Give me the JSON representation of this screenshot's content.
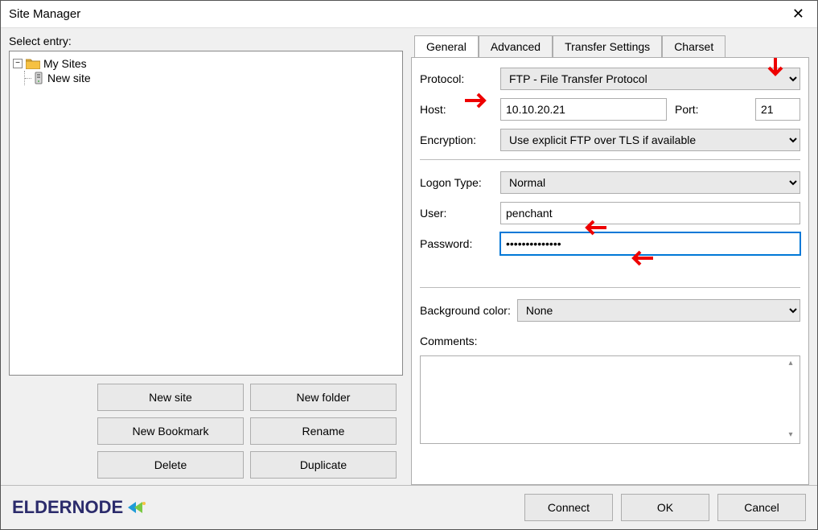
{
  "window": {
    "title": "Site Manager"
  },
  "left": {
    "select_label": "Select entry:",
    "root": {
      "label": "My Sites",
      "expanded": true
    },
    "child": {
      "label": "New site"
    },
    "buttons": {
      "new_site": "New site",
      "new_folder": "New folder",
      "new_bookmark": "New Bookmark",
      "rename": "Rename",
      "delete": "Delete",
      "duplicate": "Duplicate"
    }
  },
  "tabs": {
    "general": "General",
    "advanced": "Advanced",
    "transfer": "Transfer Settings",
    "charset": "Charset"
  },
  "fields": {
    "protocol_label": "Protocol:",
    "protocol_value": "FTP - File Transfer Protocol",
    "host_label": "Host:",
    "host_value": "10.10.20.21",
    "port_label": "Port:",
    "port_value": "21",
    "encryption_label": "Encryption:",
    "encryption_value": "Use explicit FTP over TLS if available",
    "logon_label": "Logon Type:",
    "logon_value": "Normal",
    "user_label": "User:",
    "user_value": "penchant",
    "password_label": "Password:",
    "password_value": "••••••••••••••",
    "bgcolor_label": "Background color:",
    "bgcolor_value": "None",
    "comments_label": "Comments:",
    "comments_value": ""
  },
  "footer": {
    "connect": "Connect",
    "ok": "OK",
    "cancel": "Cancel",
    "logo_text_1": "ELDER",
    "logo_text_2": "NODE"
  }
}
